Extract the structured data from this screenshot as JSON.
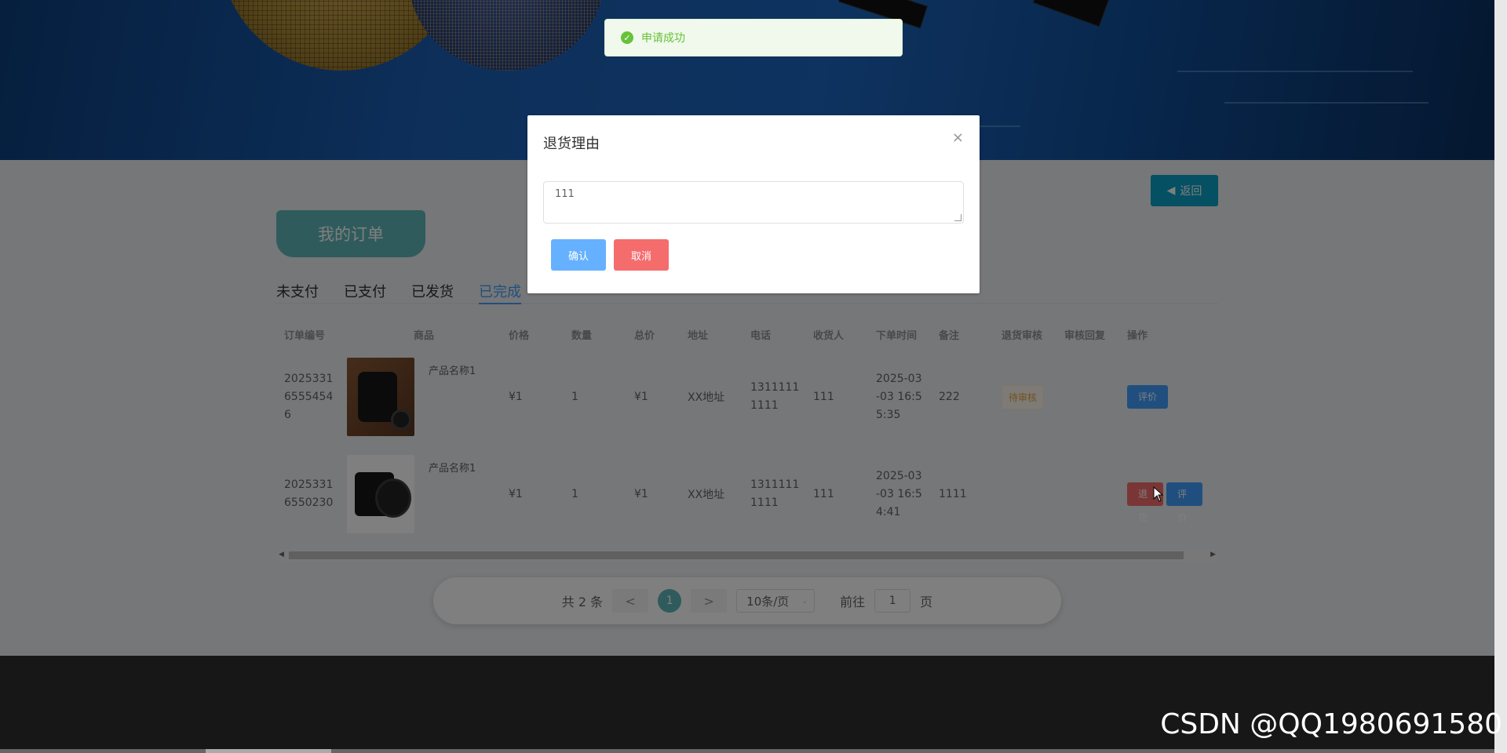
{
  "toast": {
    "message": "申请成功"
  },
  "header": {
    "return_label": "返回"
  },
  "section_title": "我的订单",
  "tabs": [
    {
      "label": "未支付",
      "active": false
    },
    {
      "label": "已支付",
      "active": false
    },
    {
      "label": "已发货",
      "active": false
    },
    {
      "label": "已完成",
      "active": true
    }
  ],
  "table": {
    "headers": [
      "订单编号",
      "商品",
      "价格",
      "数量",
      "总价",
      "地址",
      "电话",
      "收货人",
      "下单时间",
      "备注",
      "退货审核",
      "审核回复",
      "操作"
    ],
    "rows": [
      {
        "order_no": "20253316555454 6",
        "goods_name": "产品名称1",
        "price": "¥1",
        "qty": "1",
        "total": "¥1",
        "address": "XX地址",
        "phone": "1311111 1111",
        "receiver": "111",
        "time": "2025-03 -03 16:5 5:35",
        "note": "222",
        "audit": "待审核",
        "reply": "",
        "op_review": "评价"
      },
      {
        "order_no": "2025331 6550230",
        "goods_name": "产品名称1",
        "price": "¥1",
        "qty": "1",
        "total": "¥1",
        "address": "XX地址",
        "phone": "1311111 1111",
        "receiver": "111",
        "time": "2025-03 -03 16:5 4:41",
        "note": "1111",
        "audit": "",
        "reply": "",
        "op_return": "退货",
        "op_review": "评价"
      }
    ]
  },
  "pagination": {
    "total_text": "共 2 条",
    "prev": "<",
    "next": ">",
    "current_page": "1",
    "page_size": "10条/页",
    "goto_label": "前往",
    "goto_value": "1",
    "page_suffix": "页"
  },
  "dialog": {
    "title": "退货理由",
    "close_icon": "×",
    "textarea_value": "111",
    "confirm_label": "确认",
    "cancel_label": "取消"
  },
  "watermark": "CSDN @QQ1980691580",
  "colors": {
    "accent_teal": "#5fb6b8",
    "primary_blue": "#409eff",
    "danger_red": "#f56c6c",
    "success_green": "#67c23a",
    "return_btn": "#0aa0c5"
  }
}
